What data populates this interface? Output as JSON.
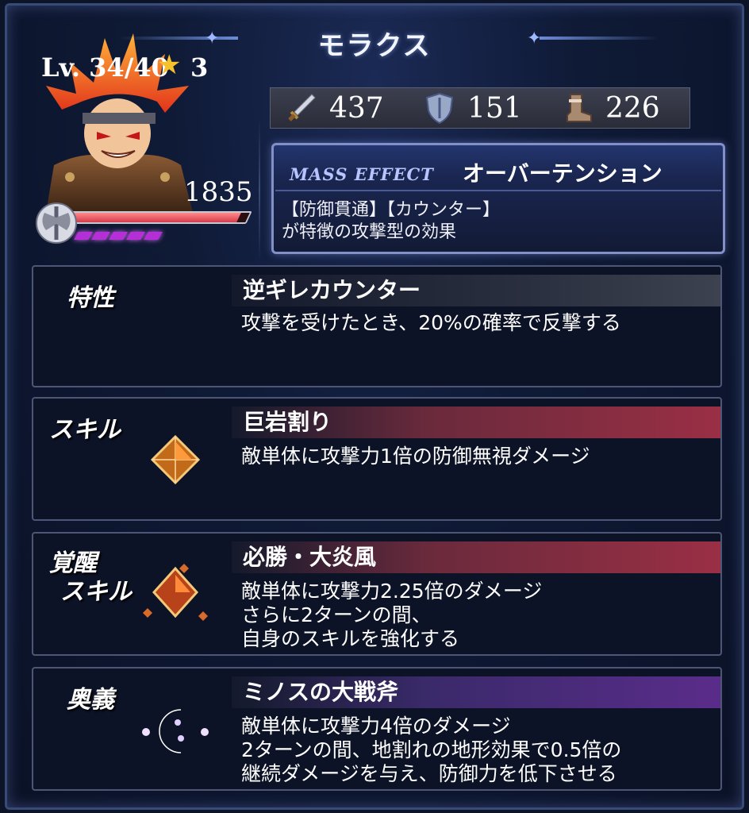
{
  "header": {
    "title": "モラクス"
  },
  "unit": {
    "level": "Lv. 34/40",
    "stars": "3",
    "hp": "1835",
    "hp_fraction": 0.95
  },
  "stats": [
    {
      "icon": "sword-icon",
      "value": "437"
    },
    {
      "icon": "shield-icon",
      "value": "151"
    },
    {
      "icon": "boot-icon",
      "value": "226"
    }
  ],
  "mass_effect": {
    "label": "MASS EFFECT",
    "name": "オーバーテンション",
    "desc_line1": "【防御貫通】【カウンター】",
    "desc_line2": "が特徴の攻撃型の効果"
  },
  "trait": {
    "label": "特性",
    "title": "逆ギレカウンター",
    "desc": "攻撃を受けたとき、20%の確率で反撃する"
  },
  "skill": {
    "label": "スキル",
    "title": "巨岩割り",
    "desc": "敵単体に攻撃力1倍の防御無視ダメージ"
  },
  "awakened_skill": {
    "label_line1": "覚醒",
    "label_line2": "スキル",
    "title": "必勝・大炎風",
    "desc_line1": "敵単体に攻撃力2.25倍のダメージ",
    "desc_line2": "さらに2ターンの間、",
    "desc_line3": "自身のスキルを強化する"
  },
  "ultimate": {
    "label": "奥義",
    "title": "ミノスの大戦斧",
    "desc_line1": "敵単体に攻撃力4倍のダメージ",
    "desc_line2": "2ターンの間、地割れの地形効果で0.5倍の",
    "desc_line3": "継続ダメージを与え、防御力を低下させる"
  }
}
